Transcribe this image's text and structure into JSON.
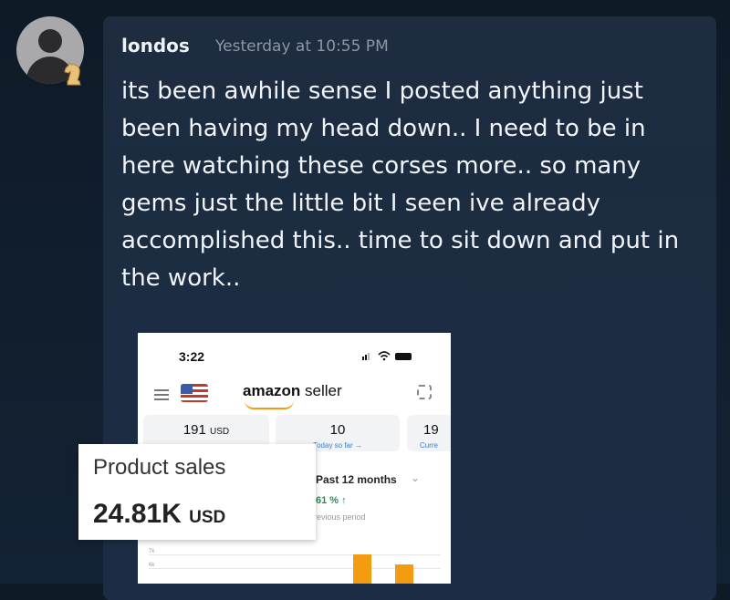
{
  "post": {
    "author": "londos",
    "timestamp": "Yesterday at 10:55 PM",
    "message": "its been awhile sense I posted anything just been having my head down.. I need to be in here watching these corses more.. so many gems just the little bit I seen ive already accomplished this.. time to sit down and put in the work.."
  },
  "screenshot": {
    "status_time": "3:22",
    "brand_bold": "amazon",
    "brand_rest": " seller",
    "tiles": [
      {
        "value": "191",
        "unit": "USD",
        "sub": ""
      },
      {
        "value": "10",
        "unit": "",
        "sub": "Today so far →"
      },
      {
        "value": "19",
        "unit": "",
        "sub": "Curre"
      }
    ],
    "period": "Past 12 months",
    "change": "61 % ↑",
    "change_sub": "previous period",
    "y_ticks": [
      "7k",
      "6k"
    ]
  },
  "overlay": {
    "label": "Product sales",
    "value": "24.81K",
    "unit": "USD"
  },
  "icons": {
    "avatar": "default-user-avatar",
    "badge": "knight-chess-badge",
    "menu": "hamburger-icon",
    "scan": "scan-icon"
  },
  "colors": {
    "background": "#0f1a27",
    "card": "#1d2c3f",
    "amazon_orange": "#f39c12"
  }
}
